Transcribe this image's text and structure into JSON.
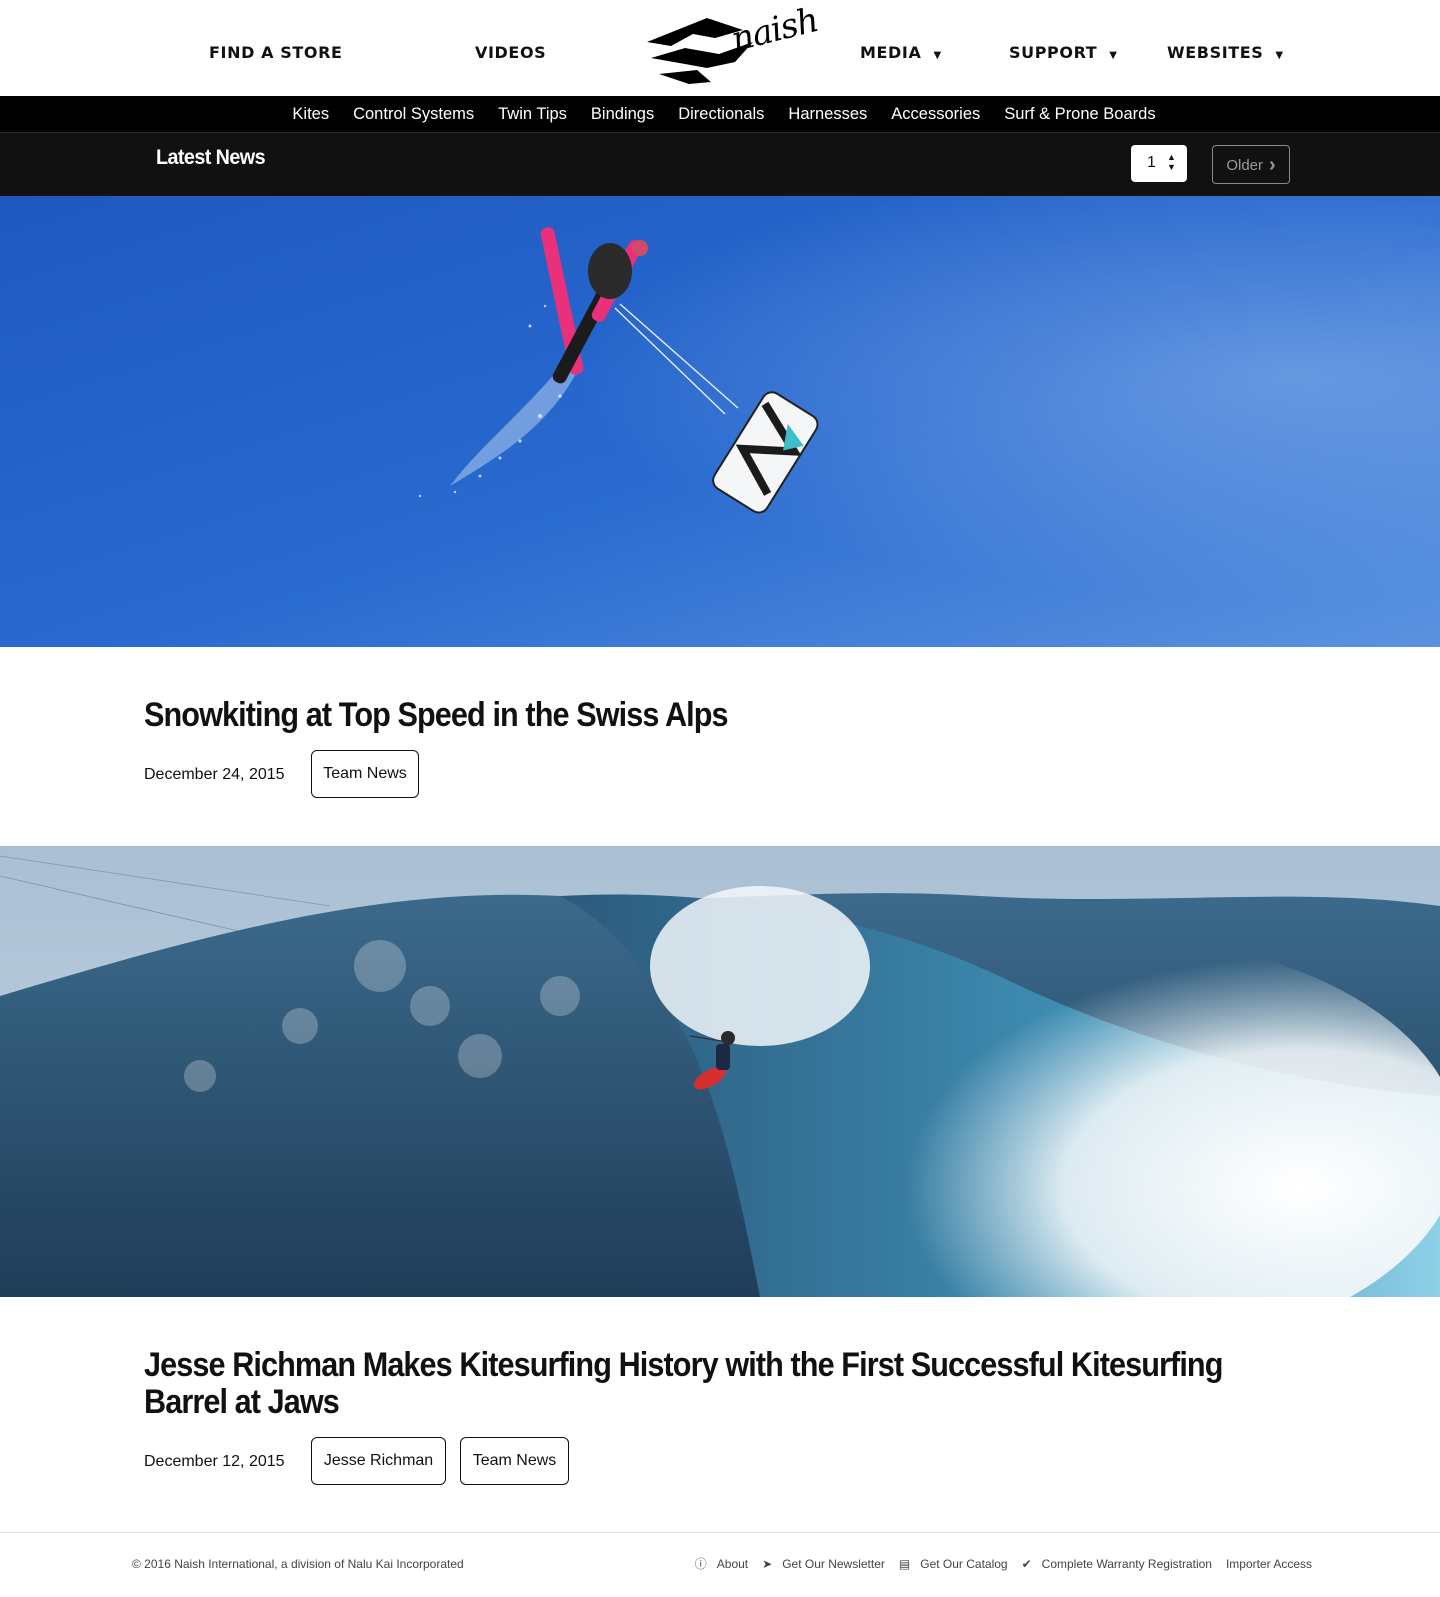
{
  "header": {
    "nav_left": [
      "FIND A STORE",
      "VIDEOS"
    ],
    "logo_text": "naish",
    "nav_right": [
      {
        "label": "MEDIA",
        "has_dropdown": true
      },
      {
        "label": "SUPPORT",
        "has_dropdown": true
      },
      {
        "label": "WEBSITES",
        "has_dropdown": true
      }
    ]
  },
  "categories": [
    "Kites",
    "Control Systems",
    "Twin Tips",
    "Bindings",
    "Directionals",
    "Harnesses",
    "Accessories",
    "Surf & Prone Boards"
  ],
  "news_bar": {
    "title": "Latest News",
    "page_value": "1",
    "older_label": "Older"
  },
  "posts": [
    {
      "title": "Snowkiting at Top Speed in the Swiss Alps",
      "date": "December 24, 2015",
      "tags": [
        "Team News"
      ],
      "image": "snowkiter-sky"
    },
    {
      "title": "Jesse Richman Makes Kitesurfing History with the First Successful Kitesurfing Barrel at Jaws",
      "date": "December 12, 2015",
      "tags": [
        "Jesse Richman",
        "Team News"
      ],
      "image": "big-wave-kitesurfer"
    }
  ],
  "footer": {
    "copyright": "© 2016 Naish International, a division of Nalu Kai Incorporated",
    "links": [
      {
        "label": "About",
        "icon": "info-icon"
      },
      {
        "label": "Get Our Newsletter",
        "icon": "send-icon"
      },
      {
        "label": "Get Our Catalog",
        "icon": "document-icon"
      },
      {
        "label": "Complete Warranty Registration",
        "icon": "check-icon"
      },
      {
        "label": "Importer Access",
        "icon": ""
      }
    ]
  },
  "colors": {
    "brand_black": "#000000",
    "sky_blue": "#2566c8",
    "ocean_blue": "#2c4f6e"
  }
}
